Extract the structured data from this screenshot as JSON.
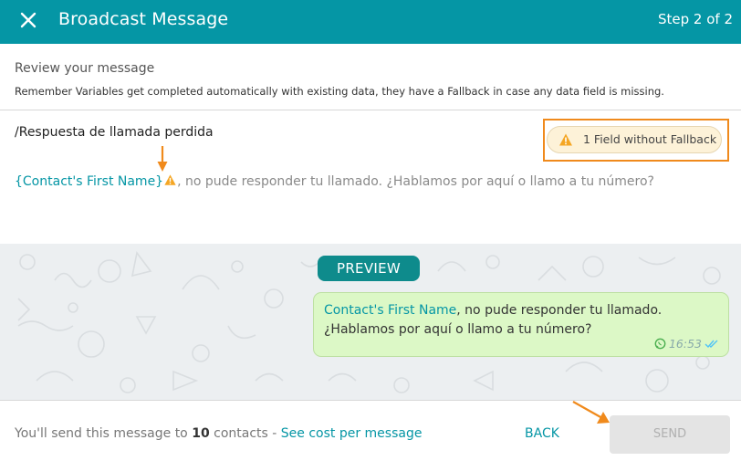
{
  "header": {
    "title": "Broadcast Message",
    "step": "Step 2 of 2",
    "close_icon": "close-icon"
  },
  "review": {
    "title": "Review your message",
    "description": "Remember Variables get completed automatically with existing data, they have a Fallback in case any data field is missing."
  },
  "template": {
    "name": "/Respuesta de llamada perdida",
    "fallback_label": "1 Field without Fallback",
    "variable": "{Contact's First Name}",
    "body_rest": ", no pude responder tu llamado. ¿Hablamos por aquí o llamo a tu número?"
  },
  "preview": {
    "badge": "PREVIEW",
    "variable": "Contact's First Name",
    "line1_rest": ", no pude responder tu llamado.",
    "line2": "¿Hablamos por aquí o llamo a tu número?",
    "time": "16:53"
  },
  "footer": {
    "prefix": "You'll send this message to ",
    "count": "10",
    "suffix": " contacts - ",
    "link": "See cost per message",
    "back": "BACK",
    "send": "SEND"
  },
  "colors": {
    "brand": "#0596a5",
    "highlight": "#f08a1c",
    "bubble": "#dcf8c6"
  }
}
